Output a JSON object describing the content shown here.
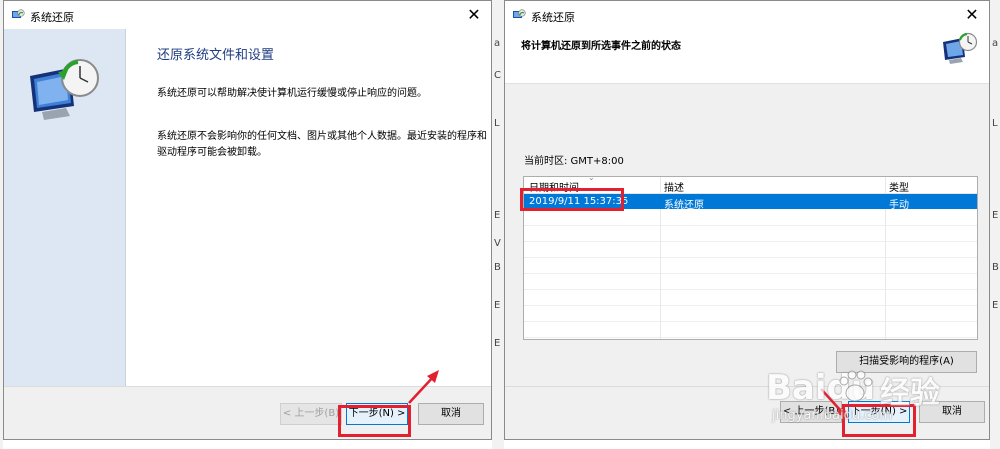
{
  "left_dialog": {
    "title": "系统还原",
    "heading": "还原系统文件和设置",
    "para1": "系统还原可以帮助解决使计算机运行缓慢或停止响应的问题。",
    "para2_line1": "系统还原不会影响你的任何文档、图片或其他个人数据。最近安装的程序和",
    "para2_line2": "驱动程序可能会被卸载。",
    "back_label": "< 上一步(B)",
    "next_label": "下一步(N) >",
    "cancel_label": "取消"
  },
  "right_dialog": {
    "title": "系统还原",
    "header_title": "将计算机还原到所选事件之前的状态",
    "timezone": "当前时区: GMT+8:00",
    "columns": [
      "日期和时间",
      "描述",
      "类型"
    ],
    "rows": [
      {
        "date": "2019/9/11 15:37:35",
        "desc": "系统还原",
        "type": "手动"
      }
    ],
    "scan_label": "扫描受影响的程序(A)",
    "back_label": "< 上一步(B)",
    "next_label": "下一步(N) >",
    "cancel_label": "取消"
  },
  "watermark": {
    "brand": "Baidu",
    "cn": "经验",
    "url": "jingyan.baidu.com"
  },
  "colors": {
    "accent": "#0078d7",
    "heading": "#1f3d82",
    "highlight_box": "#e3202f"
  }
}
